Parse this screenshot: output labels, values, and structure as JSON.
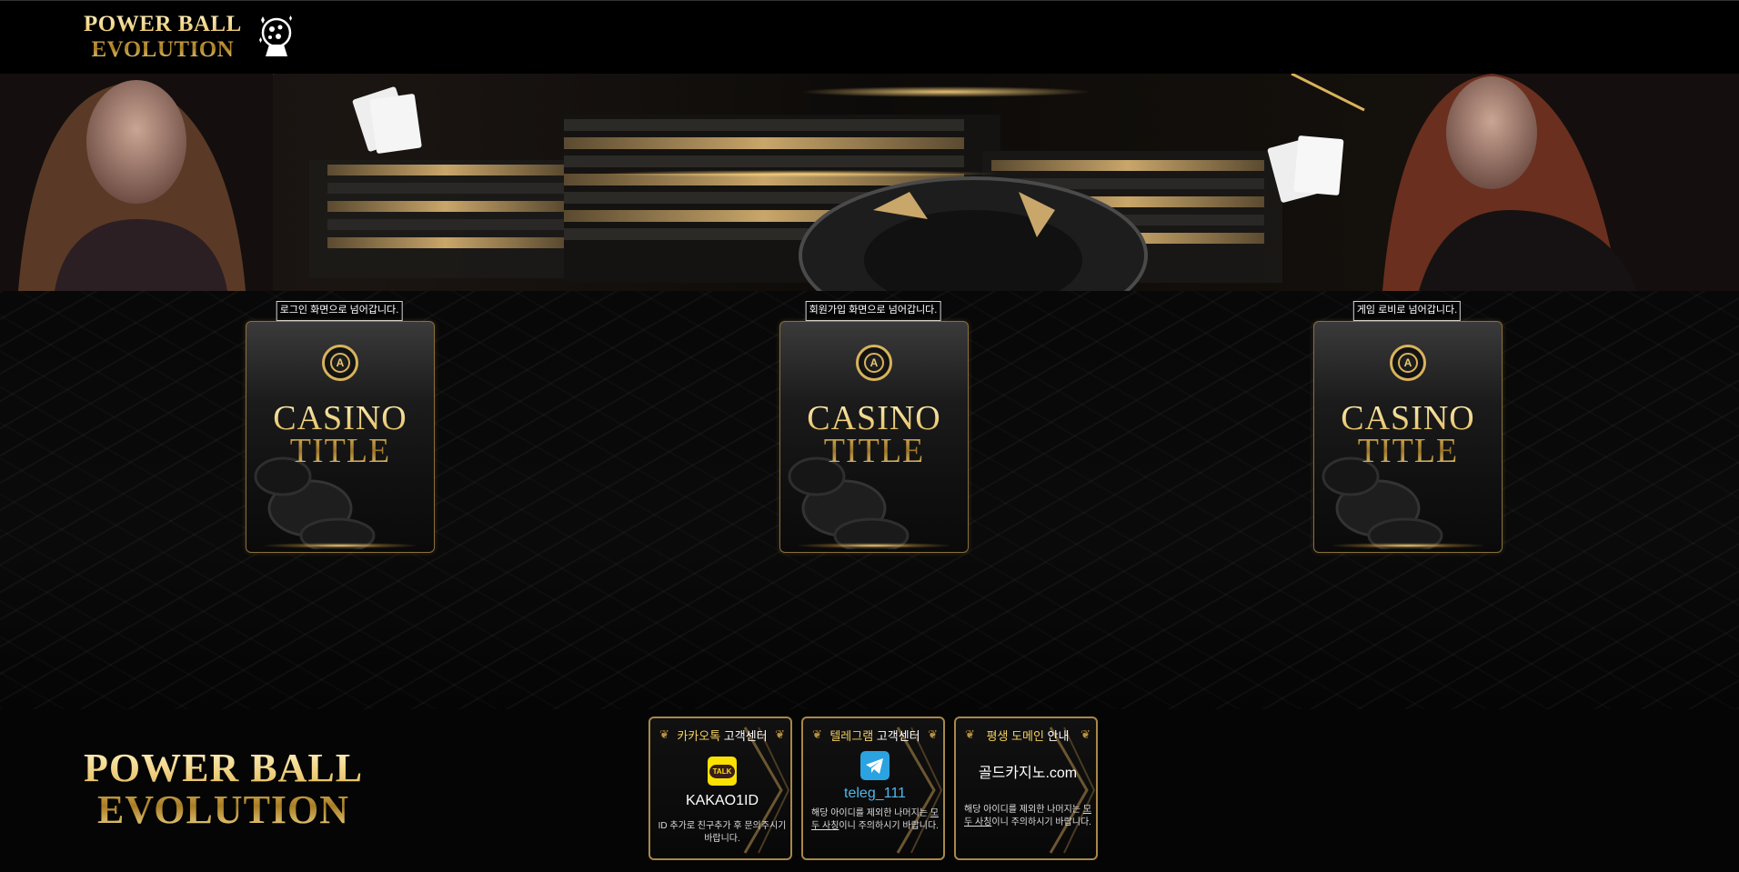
{
  "header": {
    "logo_line1": "POWER BALL",
    "logo_line2": "EVOLUTION"
  },
  "cards": [
    {
      "hint": "로그인 화면으로 넘어갑니다.",
      "title_line1": "CASINO",
      "title_line2": "TITLE",
      "emblem": "A"
    },
    {
      "hint": "회원가입 화면으로 넘어갑니다.",
      "title_line1": "CASINO",
      "title_line2": "TITLE",
      "emblem": "A"
    },
    {
      "hint": "게임 로비로 넘어갑니다.",
      "title_line1": "CASINO",
      "title_line2": "TITLE",
      "emblem": "A"
    }
  ],
  "footer": {
    "logo_line1": "POWER BALL",
    "logo_line2": "EVOLUTION",
    "support": [
      {
        "title_highlight": "카카오톡",
        "title_rest": " 고객센터",
        "icon": "kakaotalk-icon",
        "icon_label": "TALK",
        "id": "KAKAO1ID",
        "note": "ID 추가로 친구추가 후 문의주시기 바랍니다."
      },
      {
        "title_highlight": "텔레그램",
        "title_rest": " 고객센터",
        "icon": "telegram-icon",
        "id": "teleg_111",
        "note_pre": "해당 아이디를 제외한 나머지는 ",
        "note_under": "모두 사칭",
        "note_post": "이니 주의하시기 바랍니다."
      },
      {
        "title_highlight": "평생 도메인",
        "title_rest": " 안내",
        "domain": "골드카지노.com",
        "note_pre": "해당 아이디를 제외한 나머지는 ",
        "note_under": "모두 사칭",
        "note_post": "이니 주의하시기 바랍니다."
      }
    ]
  },
  "colors": {
    "gold": "#e3bf63",
    "highlight": "#f2d060",
    "telegram_blue": "#2aa3e0",
    "kakao_yellow": "#fae100"
  }
}
